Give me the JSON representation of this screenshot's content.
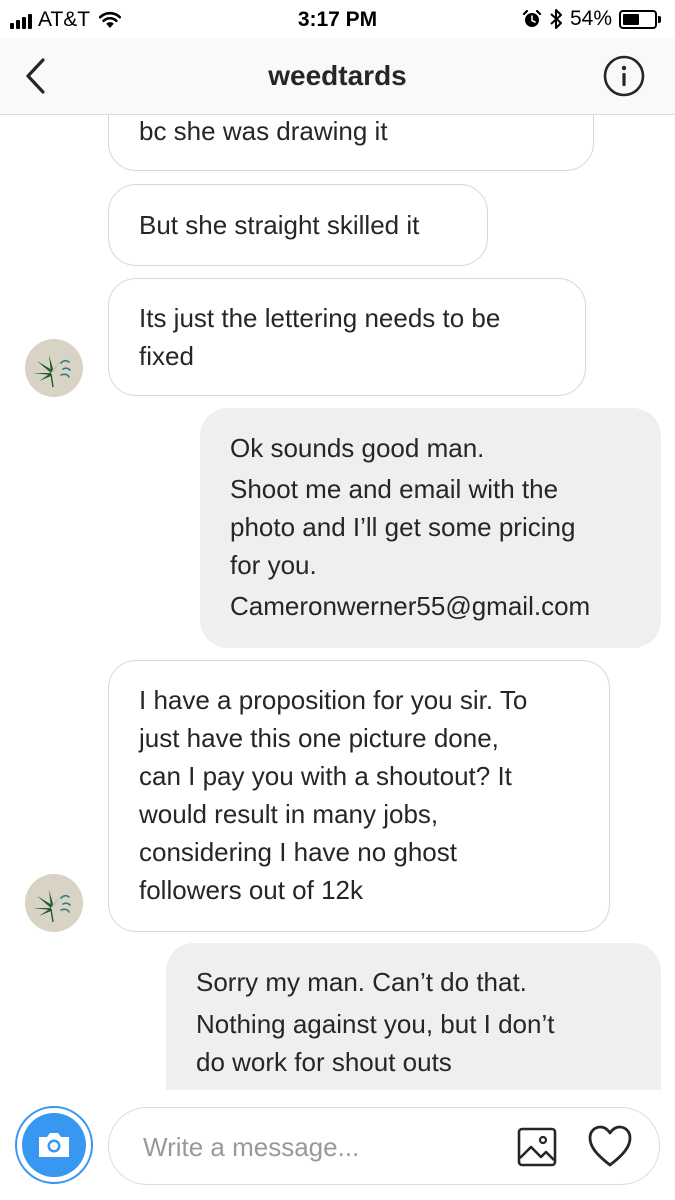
{
  "status_bar": {
    "carrier": "AT&T",
    "time": "3:17 PM",
    "battery": "54%",
    "battery_level": 0.54
  },
  "header": {
    "title": "weedtards"
  },
  "messages": [
    {
      "from": "them",
      "lines": [
        "bc she was drawing it"
      ]
    },
    {
      "from": "them",
      "lines": [
        "But she straight skilled it"
      ]
    },
    {
      "from": "them",
      "lines": [
        "Its just the lettering needs to be",
        "fixed"
      ]
    },
    {
      "from": "me",
      "lines": [
        "Ok sounds good man.",
        "Shoot me and email with the",
        "photo and I’ll get some pricing",
        "for you.",
        "Cameronwerner55@gmail.com"
      ]
    },
    {
      "from": "them",
      "lines": [
        "I have a proposition for you sir. To",
        "just have this one picture done,",
        "can I pay you with a shoutout? It",
        "would result in many jobs,",
        "considering I have no ghost",
        "followers out of 12k"
      ]
    },
    {
      "from": "me",
      "lines": [
        "Sorry my man. Can’t do that.",
        "Nothing against you, but I don’t",
        "do work for shout outs"
      ]
    }
  ],
  "composer": {
    "placeholder": "Write a message..."
  },
  "colors": {
    "accent": "#3897f0",
    "incoming_bubble_border": "#d7d7d7",
    "outgoing_bubble": "#efefef",
    "header_bg": "#f9f9f9"
  },
  "icons": [
    "back-icon",
    "info-icon",
    "camera-icon",
    "gallery-icon",
    "heart-icon",
    "wifi-icon",
    "alarm-icon",
    "bluetooth-icon",
    "battery-icon"
  ]
}
